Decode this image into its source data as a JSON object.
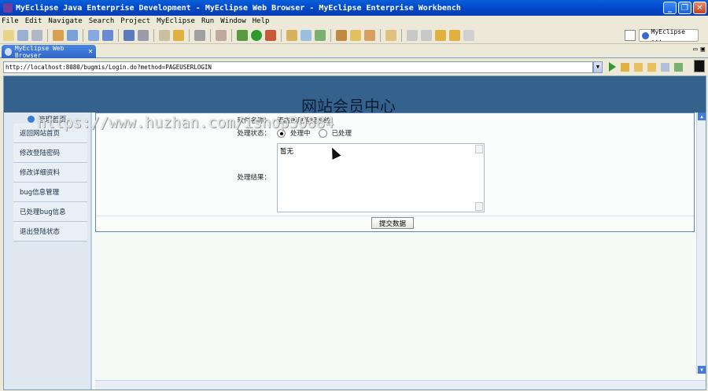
{
  "window": {
    "title": "MyEclipse Java Enterprise Development - MyEclipse Web Browser - MyEclipse Enterprise Workbench"
  },
  "menubar": {
    "items": [
      "File",
      "Edit",
      "Navigate",
      "Search",
      "Project",
      "MyEclipse",
      "Run",
      "Window",
      "Help"
    ]
  },
  "perspective": {
    "label": "MyEclipse ..."
  },
  "editor": {
    "tab_label": "MyEclipse Web Browser"
  },
  "browser": {
    "url": "http://localhost:8080/bugmis/Login.do?method=PAGEUSERLOGIN"
  },
  "page": {
    "banner_title": "网站会员中心",
    "sidebar": {
      "header": "管理首页",
      "items": [
        "返回网站首页",
        "修改登陆密码",
        "修改详细资料",
        "bug信息管理",
        "已处理bug信息",
        "退出登陆状态"
      ]
    },
    "form": {
      "software_label": "软件名称：",
      "software_value": "酒店通用管理系统",
      "status_label": "处理状态：",
      "status_options": [
        "处理中",
        "已处理"
      ],
      "result_label": "处理结果：",
      "result_value": "暂无",
      "submit_label": "提交数据"
    },
    "watermark": "https://www.huzhan.com/ishop30884"
  },
  "colors": {
    "banner": "#35628d",
    "sidebar": "#dfe8f1",
    "content_border": "#5c86b8",
    "title_bar": "#0046c8"
  }
}
